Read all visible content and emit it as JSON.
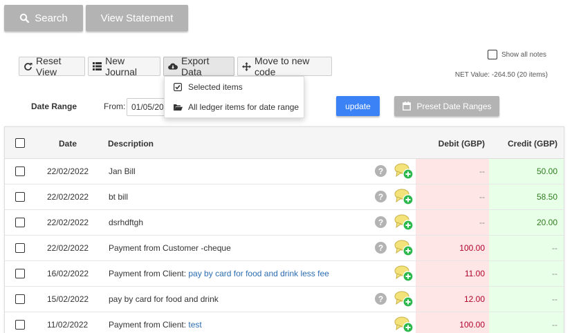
{
  "top_buttons": {
    "search": "Search",
    "view_statement": "View Statement"
  },
  "toolbar": {
    "reset_view": "Reset View",
    "new_journal": "New Journal",
    "export_data": "Export Data",
    "move_code": "Move to new code"
  },
  "export_menu": {
    "selected_items": "Selected items",
    "all_ledger": "All ledger items for date range"
  },
  "show_notes": "Show all notes",
  "net_value": "NET Value: -264.50 (20 items)",
  "date_range": {
    "label": "Date Range",
    "from_label": "From:",
    "from_value": "01/05/20"
  },
  "buttons": {
    "update": "update",
    "preset": "Preset Date Ranges"
  },
  "table": {
    "headers": {
      "date": "Date",
      "description": "Description",
      "debit": "Debit (GBP)",
      "credit": "Credit (GBP)"
    },
    "rows": [
      {
        "date": "22/02/2022",
        "desc": "Jan Bill",
        "link": "",
        "debit": "--",
        "credit": "50.00",
        "q": true
      },
      {
        "date": "22/02/2022",
        "desc": "bt bill",
        "link": "",
        "debit": "--",
        "credit": "58.50",
        "q": true
      },
      {
        "date": "22/02/2022",
        "desc": "dsrhdftgh",
        "link": "",
        "debit": "--",
        "credit": "20.00",
        "q": true
      },
      {
        "date": "22/02/2022",
        "desc": "Payment from Customer -cheque",
        "link": "",
        "debit": "100.00",
        "credit": "--",
        "q": true
      },
      {
        "date": "16/02/2022",
        "desc": "Payment from Client: ",
        "link": "pay by card for food and drink less fee",
        "debit": "11.00",
        "credit": "--",
        "q": false
      },
      {
        "date": "15/02/2022",
        "desc": "pay by card for food and drink",
        "link": "",
        "debit": "12.00",
        "credit": "--",
        "q": true
      },
      {
        "date": "11/02/2022",
        "desc": "Payment from Client: ",
        "link": "test",
        "debit": "100.00",
        "credit": "--",
        "q": false
      }
    ]
  },
  "colors": {
    "accent": "#3b82f6",
    "gray_button": "#b3b3b3",
    "debit_bg": "#ffe6e6",
    "credit_bg": "#e8ffe8"
  }
}
